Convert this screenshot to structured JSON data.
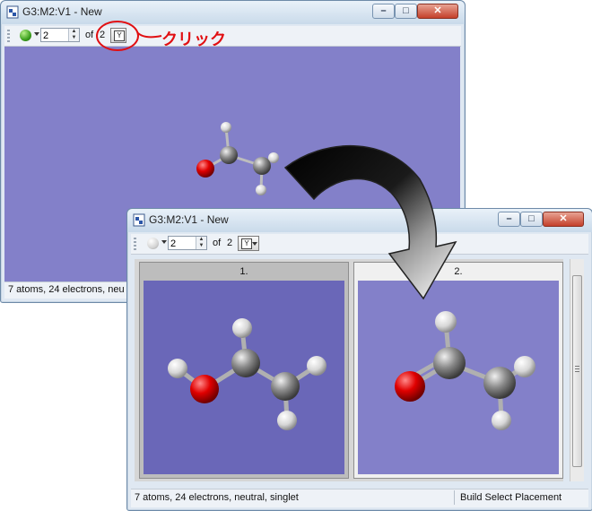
{
  "colors": {
    "annotation": "#e10f12",
    "viewport_bg": "#8380c9",
    "panel_active_bg": "#6a67b8"
  },
  "back_window": {
    "title": "G3:M2:V1 - New",
    "toolbar": {
      "frame_value": "2",
      "of_label": "of",
      "frame_total": "2",
      "tile_icon": "tile-frames-icon"
    },
    "status": "7 atoms, 24 electrons, neu"
  },
  "front_window": {
    "title": "G3:M2:V1 - New",
    "toolbar": {
      "frame_value": "2",
      "of_label": "of",
      "frame_total": "2",
      "tile_icon": "tile-frames-icon"
    },
    "panels": [
      {
        "label": "1."
      },
      {
        "label": "2."
      }
    ],
    "status": "7 atoms, 24 electrons, neutral, singlet",
    "modes": "Build Select Placement"
  },
  "annotation": {
    "text": "クリック"
  }
}
